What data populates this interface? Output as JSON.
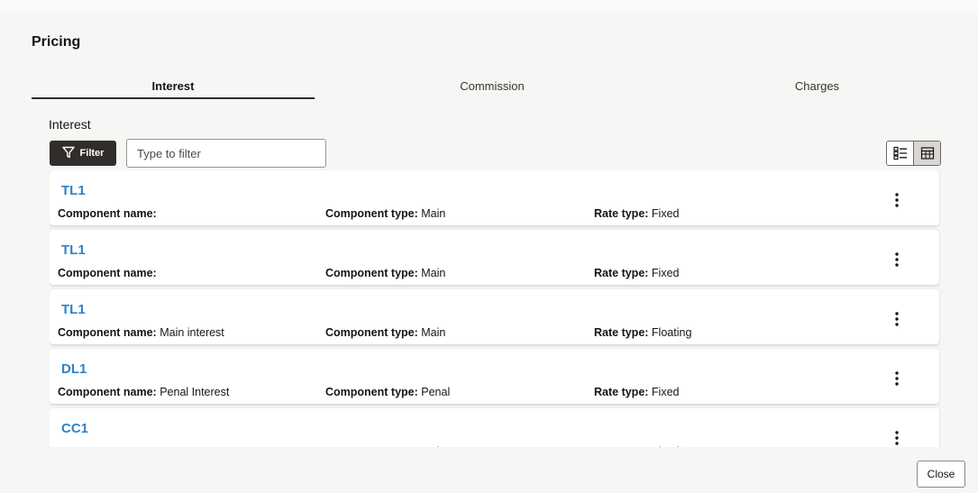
{
  "dialog": {
    "title": "Pricing"
  },
  "tabs": [
    {
      "label": "Interest"
    },
    {
      "label": "Commission"
    },
    {
      "label": "Charges"
    }
  ],
  "section": {
    "label": "Interest"
  },
  "filter": {
    "button_label": "Filter",
    "placeholder": "Type to filter"
  },
  "view_toggle": {
    "list_icon": "list-view-icon",
    "table_icon": "table-view-icon"
  },
  "field_labels": {
    "component_name": "Component name:",
    "component_type": "Component type:",
    "rate_type": "Rate type:"
  },
  "rows": [
    {
      "code": "TL1",
      "component_name": "",
      "component_type": "Main",
      "rate_type": "Fixed"
    },
    {
      "code": "TL1",
      "component_name": "",
      "component_type": "Main",
      "rate_type": "Fixed"
    },
    {
      "code": "TL1",
      "component_name": "Main interest",
      "component_type": "Main",
      "rate_type": "Floating"
    },
    {
      "code": "DL1",
      "component_name": "Penal Interest",
      "component_type": "Penal",
      "rate_type": "Fixed"
    },
    {
      "code": "CC1",
      "component_name": "",
      "component_type": "Main",
      "rate_type": "Floating"
    }
  ],
  "footer": {
    "close_label": "Close"
  }
}
